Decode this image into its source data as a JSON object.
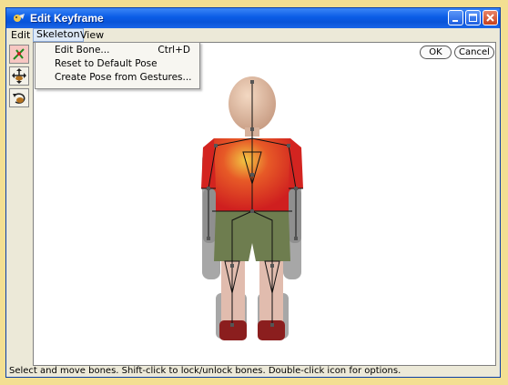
{
  "window": {
    "title": "Edit Keyframe"
  },
  "menubar": {
    "items": [
      "Edit",
      "Skeleton",
      "View"
    ],
    "active": "Skeleton"
  },
  "dropdown": {
    "items": [
      {
        "label": "Edit Bone...",
        "shortcut": "Ctrl+D"
      },
      {
        "label": "Reset to Default Pose",
        "shortcut": ""
      },
      {
        "label": "Create Pose from Gestures...",
        "shortcut": ""
      }
    ]
  },
  "toolbar": {
    "tools": [
      "bone-select-icon",
      "move-icon",
      "rotate-icon"
    ]
  },
  "buttons": {
    "ok": "OK",
    "cancel": "Cancel"
  },
  "status": {
    "text": "Select and move bones.  Shift-click to lock/unlock bones.  Double-click icon for options."
  },
  "colors": {
    "titlebar": "#0a5ce6",
    "background": "#f3df92",
    "shirt": "#d8251f",
    "shorts": "#6a7a4d",
    "skin": "#e2b89c"
  }
}
